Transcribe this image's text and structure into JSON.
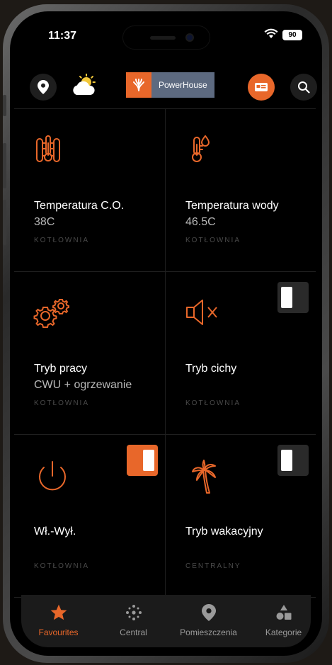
{
  "status_bar": {
    "time": "11:37",
    "battery": "90"
  },
  "header": {
    "brand_name": "PowerHouse"
  },
  "tiles": [
    {
      "name": "Temperatura C.O.",
      "value": "38C",
      "room": "KOTŁOWNIA",
      "icon": "radiator-thermometer-icon"
    },
    {
      "name": "Temperatura wody",
      "value": "46.5C",
      "room": "KOTŁOWNIA",
      "icon": "water-thermometer-icon"
    },
    {
      "name": "Tryb pracy",
      "value": "CWU + ogrzewanie",
      "room": "KOTŁOWNIA",
      "icon": "gears-icon"
    },
    {
      "name": "Tryb cichy",
      "value": "",
      "room": "KOTŁOWNIA",
      "icon": "speaker-mute-icon",
      "toggle": "off"
    },
    {
      "name": "Wł.-Wył.",
      "value": "",
      "room": "KOTŁOWNIA",
      "icon": "power-icon",
      "toggle": "on"
    },
    {
      "name": "Tryb wakacyjny",
      "value": "",
      "room": "CENTRALNY",
      "icon": "palm-tree-icon",
      "toggle": "off"
    }
  ],
  "nav": {
    "items": [
      {
        "label": "Favourites",
        "icon": "star-icon",
        "active": true
      },
      {
        "label": "Central",
        "icon": "dots-grid-icon",
        "active": false
      },
      {
        "label": "Pomieszczenia",
        "icon": "location-pin-icon",
        "active": false
      },
      {
        "label": "Kategorie",
        "icon": "shapes-icon",
        "active": false
      }
    ]
  },
  "colors": {
    "accent": "#e8672a",
    "brand_gray": "#5d6a80",
    "background": "#000000"
  }
}
